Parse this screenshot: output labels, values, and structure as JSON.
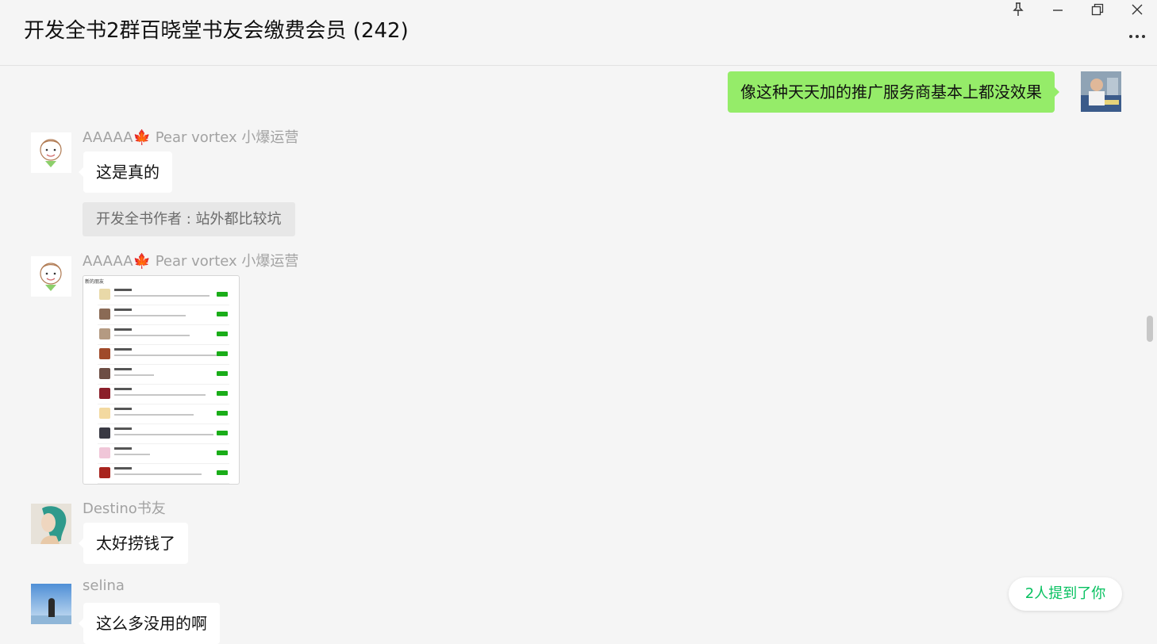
{
  "window": {
    "title": "开发全书2群百晓堂书友会缴费会员 (242)",
    "controls": [
      "pin-icon",
      "minimize-icon",
      "restore-icon",
      "close-icon"
    ],
    "more_icon": "more-icon"
  },
  "messages": {
    "m1": {
      "text": "像这种天天加的推广服务商基本上都没效果",
      "bubble_color": "#95ec69"
    },
    "m2": {
      "sender": "AAAAA🍁 Pear vortex 小爆运营",
      "text": "这是真的",
      "quote": "开发全书作者 : 站外都比较坑"
    },
    "m3": {
      "sender": "AAAAA🍁 Pear vortex 小爆运营",
      "image_header": "新的朋友"
    },
    "m4": {
      "sender": "Destino书友",
      "text": "太好捞钱了"
    },
    "m5": {
      "sender": "selina",
      "text": "这么多没用的啊"
    }
  },
  "mention_pill": {
    "text": "2人提到了你",
    "color": "#07c160"
  }
}
